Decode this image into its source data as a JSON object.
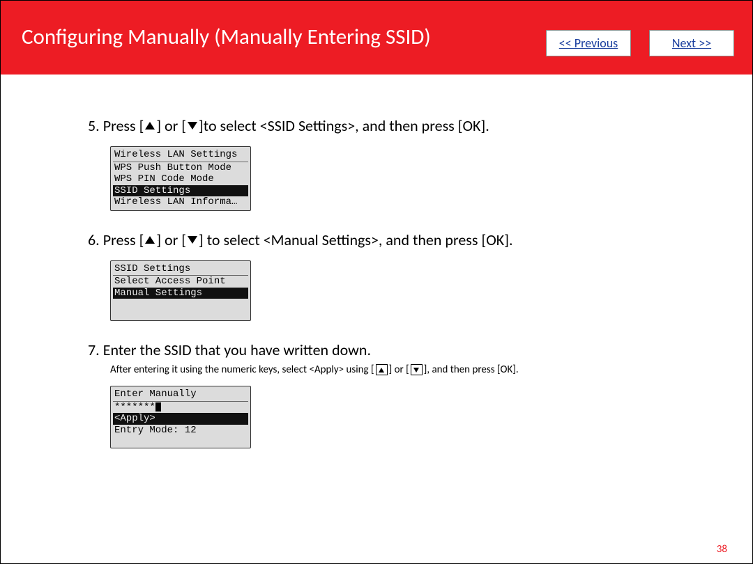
{
  "header": {
    "title": "Configuring Manually (Manually Entering SSID)",
    "prev": "<< Previous",
    "next": "Next >>"
  },
  "steps": {
    "s5": {
      "num": "5.",
      "a": "Press [",
      "b": "] or [",
      "c": "]to select <SSID Settings>, and then press [OK]."
    },
    "s6": {
      "num": "6.",
      "a": "Press [",
      "b": "] or [",
      "c": "] to select <Manual Settings>, and then press [OK]."
    },
    "s7": {
      "num": "7.",
      "text": "Enter the SSID that you have written down."
    }
  },
  "lcd1": {
    "title": "Wireless LAN Settings",
    "r1": "WPS Push Button Mode",
    "r2": "WPS PIN Code Mode",
    "sel": "SSID Settings",
    "r3": "Wireless LAN Informa…"
  },
  "lcd2": {
    "title": "SSID Settings",
    "r1": "Select Access Point",
    "sel": "Manual Settings"
  },
  "lcd3": {
    "title": "Enter Manually",
    "stars": "*******",
    "apply": "<Apply>",
    "mode": "Entry Mode: 12"
  },
  "sub": {
    "a": "After entering it using the numeric keys, select <Apply> using [",
    "b": "] or [",
    "c": "], and then press [OK]."
  },
  "pagenum": "38"
}
